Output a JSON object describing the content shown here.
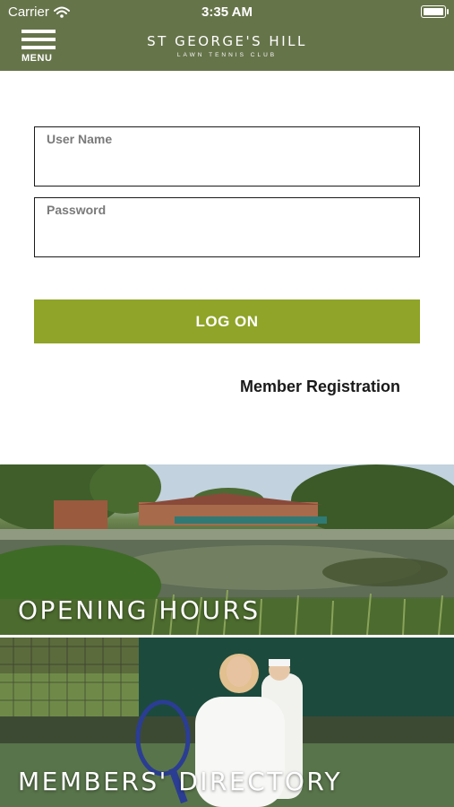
{
  "status_bar": {
    "carrier": "Carrier",
    "time": "3:35 AM"
  },
  "header": {
    "menu_label": "MENU",
    "brand_name": "ST GEORGE'S HILL",
    "brand_sub": "LAWN TENNIS CLUB",
    "bg_color": "#66744a"
  },
  "login": {
    "username_label": "User Name",
    "username_value": "",
    "password_label": "Password",
    "password_value": "",
    "logon_label": "LOG ON",
    "button_color": "#8fa428",
    "registration_link": "Member Registration"
  },
  "tiles": [
    {
      "title": "OPENING HOURS",
      "image": "clubhouse-lake-photo"
    },
    {
      "title": "MEMBERS' DIRECTORY",
      "image": "tennis-players-photo"
    }
  ]
}
